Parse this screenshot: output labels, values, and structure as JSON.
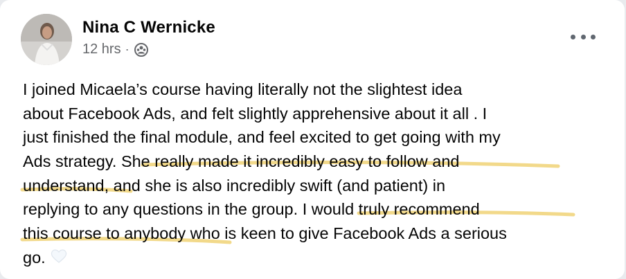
{
  "post": {
    "author": "Nina C Wernicke",
    "time": "12 hrs",
    "separator": "·",
    "lines": [
      "I joined Micaela’s course having literally not the slightest idea",
      "about Facebook Ads, and felt slightly apprehensive about it all  . I",
      "just finished the final module, and feel excited to get going with my",
      "Ads strategy.",
      "She really made it incredibly easy to follow and",
      "understand,",
      "and she is also incredibly swift (and patient) in",
      "replying to any questions in the group.",
      "I would truly recommend",
      "this course to anybody",
      "who is keen to give Facebook Ads a serious",
      "go."
    ]
  },
  "colors": {
    "underline": "#f2d98a",
    "text": "#050505",
    "meta": "#65676b"
  },
  "icons": {
    "audience": "group-icon",
    "menu": "more-options-icon",
    "reaction": "heart-icon"
  }
}
